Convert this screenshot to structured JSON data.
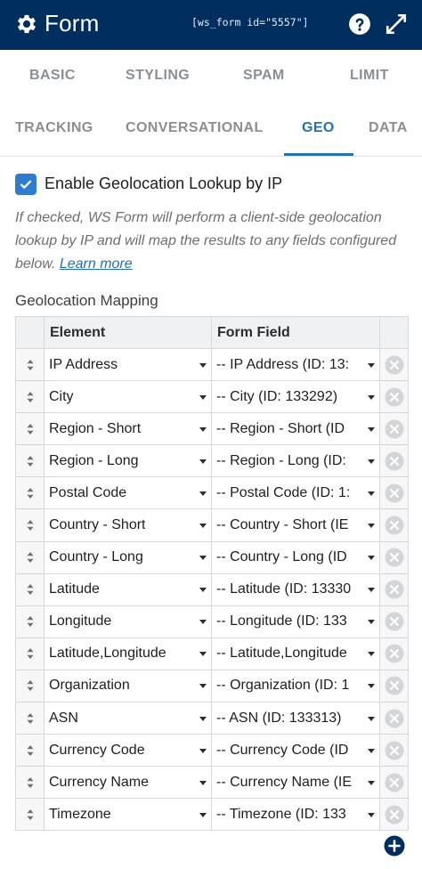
{
  "header": {
    "title": "Form",
    "shortcode": "[ws_form id=\"5557\"]",
    "background": "#002e5f",
    "icons": [
      "gear-icon",
      "help-icon",
      "expand-icon"
    ]
  },
  "tabs": {
    "row1": [
      "BASIC",
      "STYLING",
      "SPAM",
      "LIMIT"
    ],
    "row2": [
      "TRACKING",
      "CONVERSATIONAL",
      "GEO",
      "DATA"
    ],
    "active": "GEO",
    "accent": "#2271b1"
  },
  "geo": {
    "enable_label": "Enable Geolocation Lookup by IP",
    "enable_checked": true,
    "help_text": "If checked, WS Form will perform a client-side geolocation lookup by IP and will map the results to any fields configured below.",
    "learn_more": "Learn more",
    "mapping_title": "Geolocation Mapping",
    "columns": [
      "Element",
      "Form Field"
    ],
    "rows": [
      {
        "element": "IP Address",
        "field": "-- IP Address (ID: 13:"
      },
      {
        "element": "City",
        "field": "-- City (ID: 133292)"
      },
      {
        "element": "Region - Short",
        "field": "-- Region - Short (ID"
      },
      {
        "element": "Region - Long",
        "field": "-- Region - Long (ID:"
      },
      {
        "element": "Postal Code",
        "field": "-- Postal Code (ID: 1:"
      },
      {
        "element": "Country - Short",
        "field": "-- Country - Short (IE"
      },
      {
        "element": "Country - Long",
        "field": "-- Country - Long (ID"
      },
      {
        "element": "Latitude",
        "field": "-- Latitude (ID: 13330"
      },
      {
        "element": "Longitude",
        "field": "-- Longitude (ID: 133"
      },
      {
        "element": "Latitude,Longitude",
        "field": "-- Latitude,Longitude"
      },
      {
        "element": "Organization",
        "field": "-- Organization (ID: 1"
      },
      {
        "element": "ASN",
        "field": "-- ASN (ID: 133313)"
      },
      {
        "element": "Currency Code",
        "field": "-- Currency Code (ID"
      },
      {
        "element": "Currency Name",
        "field": "-- Currency Name (IE"
      },
      {
        "element": "Timezone",
        "field": "-- Timezone (ID: 133"
      }
    ]
  }
}
